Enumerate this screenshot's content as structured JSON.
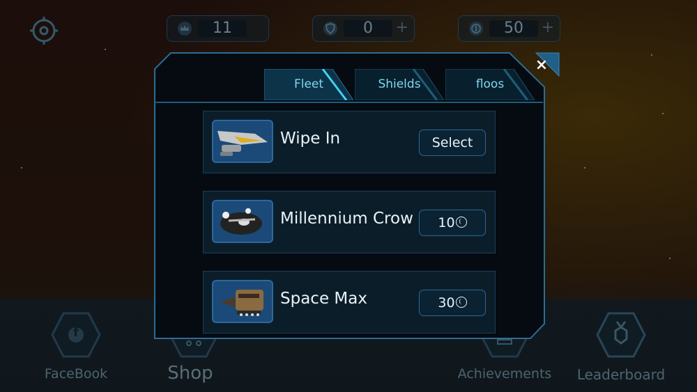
{
  "hud": {
    "crowns": "11",
    "shields": "0",
    "coins": "50",
    "plus": "+"
  },
  "tabs": [
    {
      "label": "Fleet",
      "active": true
    },
    {
      "label": "Shields",
      "active": false
    },
    {
      "label": "floos",
      "active": false
    }
  ],
  "close_label": "×",
  "items": [
    {
      "name": "Wipe In",
      "action": "Select",
      "price": null,
      "icon": "ship-wipe-in-icon"
    },
    {
      "name": "Millennium Crow",
      "action": null,
      "price": "10",
      "icon": "ship-millennium-crow-icon"
    },
    {
      "name": "Space Max",
      "action": null,
      "price": "30",
      "icon": "ship-space-max-icon"
    }
  ],
  "nav": {
    "facebook": "FaceBook",
    "shop": "Shop",
    "achievements": "Achievements",
    "leaderboard": "Leaderboard",
    "facebook_glyph": "f"
  },
  "colors": {
    "accent": "#3fd3f0",
    "frame": "#2b6d96",
    "text": "#e9f3f8"
  }
}
